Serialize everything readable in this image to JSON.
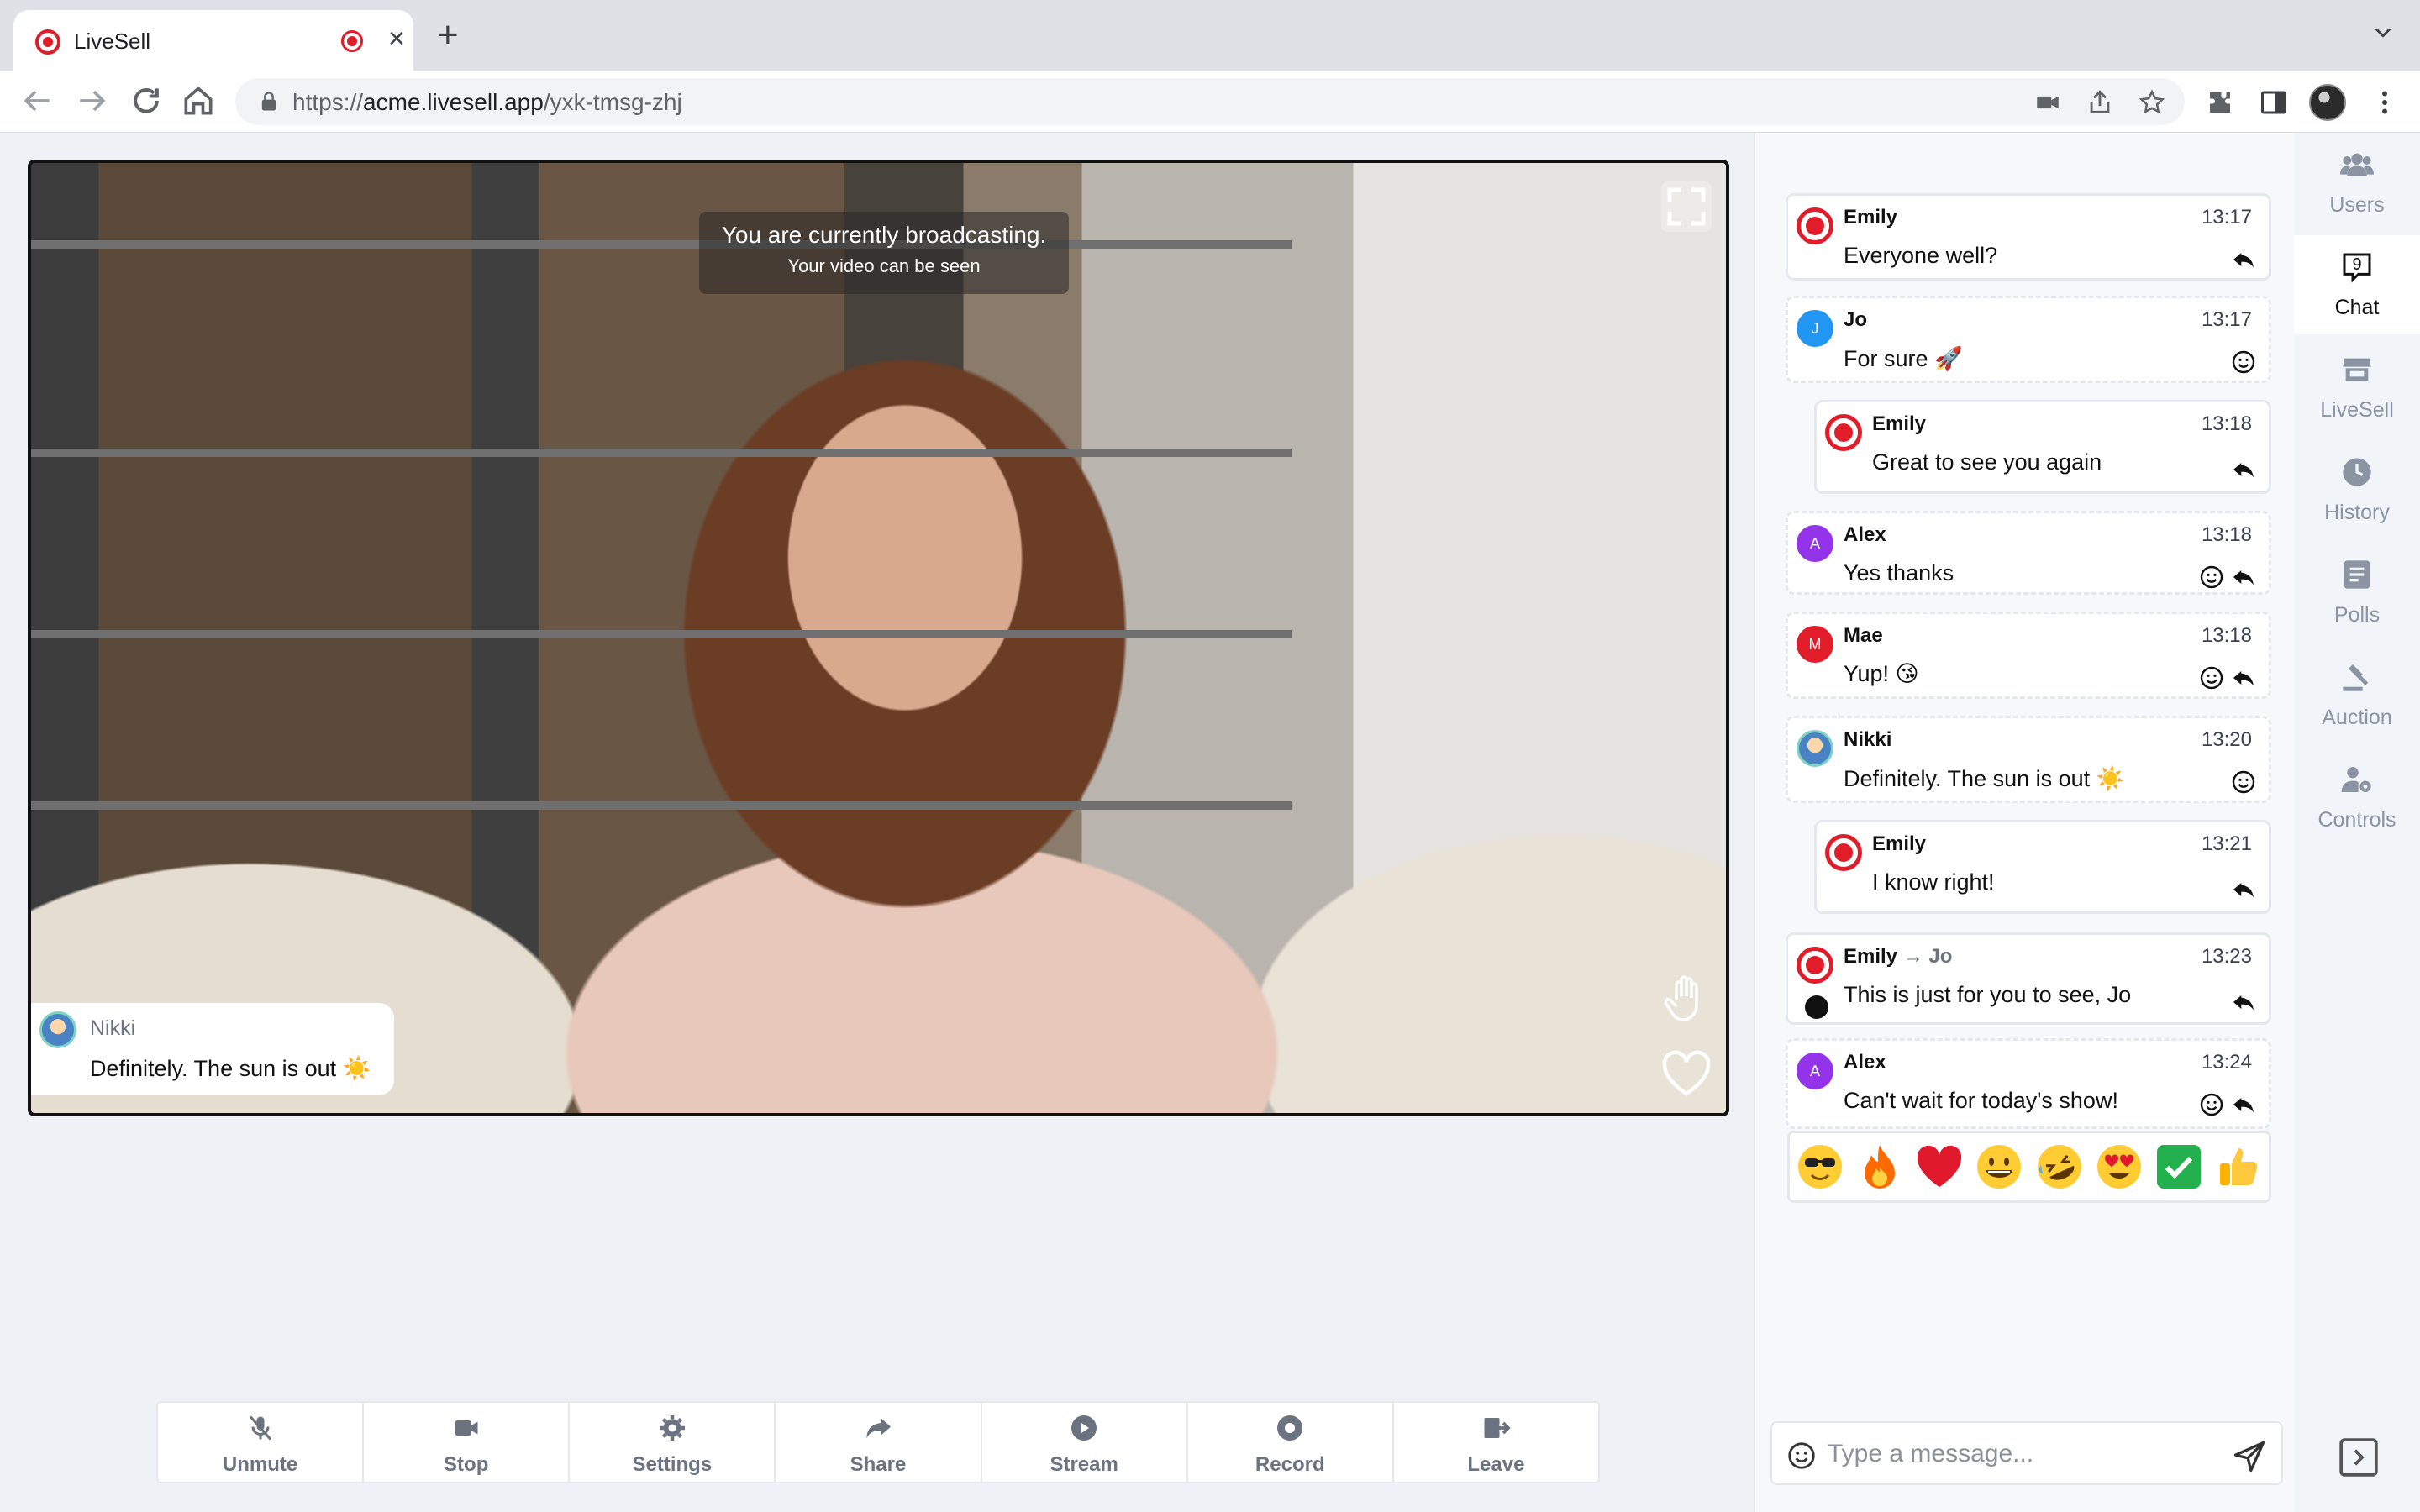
{
  "browser": {
    "tab_title": "LiveSell",
    "url_scheme": "https://",
    "url_host": "acme.livesell.app",
    "url_path": "/yxk-tmsg-zhj"
  },
  "video": {
    "broadcast_line1": "You are currently broadcasting.",
    "broadcast_line2": "Your video can be seen",
    "pinned": {
      "name": "Nikki",
      "text": "Definitely. The sun is out ☀️"
    }
  },
  "controls": [
    {
      "label": "Unmute",
      "icon": "mic-off-icon"
    },
    {
      "label": "Stop",
      "icon": "video-camera-icon"
    },
    {
      "label": "Settings",
      "icon": "gear-icon"
    },
    {
      "label": "Share",
      "icon": "share-arrow-icon"
    },
    {
      "label": "Stream",
      "icon": "play-circle-icon"
    },
    {
      "label": "Record",
      "icon": "record-icon"
    },
    {
      "label": "Leave",
      "icon": "exit-icon"
    }
  ],
  "chat": {
    "messages": [
      {
        "name": "Emily",
        "time": "13:17",
        "text": "Everyone well?",
        "avatar": "logo",
        "actions": [
          "reply"
        ]
      },
      {
        "name": "Jo",
        "time": "13:17",
        "text": "For sure 🚀",
        "avatar": "J",
        "avatar_color": "#2196f3",
        "actions": [
          "react"
        ]
      },
      {
        "name": "Emily",
        "time": "13:18",
        "text": "Great to see you again",
        "avatar": "logo",
        "actions": [
          "reply"
        ]
      },
      {
        "name": "Alex",
        "time": "13:18",
        "text": "Yes thanks",
        "avatar": "A",
        "avatar_color": "#9333ea",
        "actions": [
          "react",
          "reply"
        ]
      },
      {
        "name": "Mae",
        "time": "13:18",
        "text": "Yup! 😘",
        "avatar": "M",
        "avatar_color": "#e11d2a",
        "actions": [
          "react",
          "reply"
        ]
      },
      {
        "name": "Nikki",
        "time": "13:20",
        "text": "Definitely. The sun is out ☀️",
        "avatar": "photo",
        "actions": [
          "react"
        ]
      },
      {
        "name": "Emily",
        "time": "13:21",
        "text": "I know right!",
        "avatar": "logo",
        "actions": [
          "reply"
        ]
      },
      {
        "name": "Emily",
        "to": "Jo",
        "time": "13:23",
        "text": "This is just for you to see, Jo",
        "avatar": "logo",
        "actions": [
          "reply"
        ]
      },
      {
        "name": "Alex",
        "time": "13:24",
        "text": "Can't wait for today's show!",
        "avatar": "A",
        "avatar_color": "#9333ea",
        "actions": [
          "react",
          "reply"
        ]
      }
    ],
    "quick_reactions": [
      "😎",
      "🔥",
      "❤️",
      "😀",
      "🤣",
      "😍",
      "✅",
      "👍"
    ],
    "input_placeholder": "Type a message..."
  },
  "nav": {
    "items": [
      {
        "label": "Users",
        "icon": "users-icon"
      },
      {
        "label": "Chat",
        "icon": "chat-icon",
        "badge": "9"
      },
      {
        "label": "LiveSell",
        "icon": "store-icon"
      },
      {
        "label": "History",
        "icon": "clock-icon"
      },
      {
        "label": "Polls",
        "icon": "poll-icon"
      },
      {
        "label": "Auction",
        "icon": "gavel-icon"
      },
      {
        "label": "Controls",
        "icon": "user-gear-icon"
      }
    ],
    "active": "Chat"
  },
  "colors": {
    "brand_red": "#e11d2a",
    "accent_gray": "#6b7280"
  }
}
